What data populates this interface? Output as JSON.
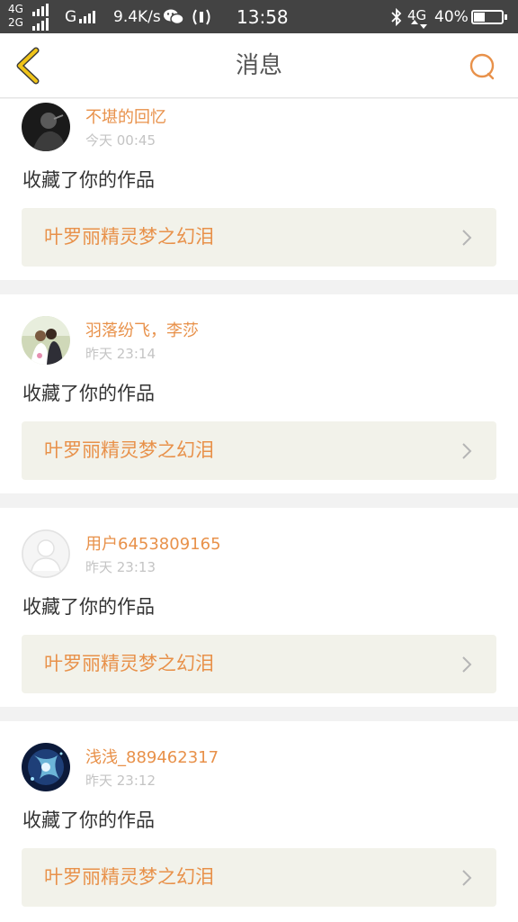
{
  "status_bar": {
    "net_top": "4G",
    "net_bottom": "2G",
    "net_g": "G",
    "speed": "9.4K/s",
    "time": "13:58",
    "net_right": "4G",
    "battery": "40%",
    "battery_level": 0.4
  },
  "header": {
    "title": "消息",
    "back_icon": "chevron-left-icon",
    "search_icon": "search-icon",
    "accent": "#e8914a",
    "back_color": "#f0c419"
  },
  "messages": [
    {
      "username": "不堪的回忆",
      "time": "今天 00:45",
      "action": "收藏了你的作品",
      "work": "叶罗丽精灵梦之幻泪",
      "avatar": "dark-photo-avatar"
    },
    {
      "username": "羽落纷飞，李莎",
      "time": "昨天 23:14",
      "action": "收藏了你的作品",
      "work": "叶罗丽精灵梦之幻泪",
      "avatar": "wedding-photo-avatar"
    },
    {
      "username": "用户6453809165",
      "time": "昨天 23:13",
      "action": "收藏了你的作品",
      "work": "叶罗丽精灵梦之幻泪",
      "avatar": "default-user-avatar"
    },
    {
      "username": "浅浅_889462317",
      "time": "昨天 23:12",
      "action": "收藏了你的作品",
      "work": "叶罗丽精灵梦之幻泪",
      "avatar": "anime-avatar"
    }
  ]
}
